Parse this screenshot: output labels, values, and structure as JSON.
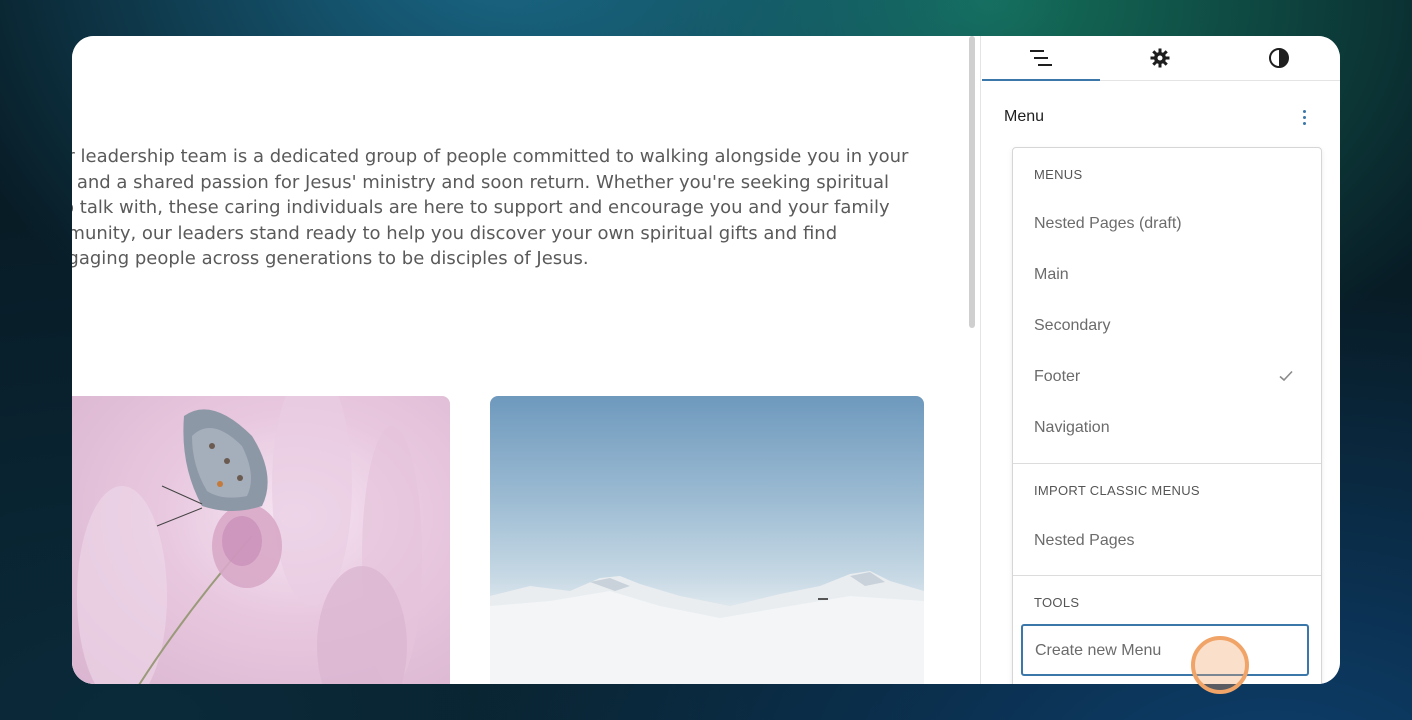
{
  "content": {
    "paragraph_lines": [
      "ur leadership team is a dedicated group of people committed to walking alongside you in your",
      "s, and a shared passion for Jesus' ministry and soon return. Whether you're seeking spiritual",
      "to talk with, these caring individuals are here to support and encourage you and your family",
      "nmunity, our leaders stand ready to help you discover your own spiritual gifts and find",
      "ngaging people across generations to be disciples of Jesus."
    ]
  },
  "sidebar": {
    "tabs": [
      {
        "icon": "list-view-icon",
        "active": true
      },
      {
        "icon": "gear-icon",
        "active": false
      },
      {
        "icon": "contrast-icon",
        "active": false
      }
    ],
    "menu_title": "Menu",
    "dropdown": {
      "menus_label": "MENUS",
      "menus": [
        "Nested Pages (draft)",
        "Main",
        "Secondary",
        "Footer",
        "Navigation"
      ],
      "selected": "Footer",
      "import_label": "IMPORT CLASSIC MENUS",
      "import_items": [
        "Nested Pages"
      ],
      "tools_label": "TOOLS",
      "create_label": "Create new Menu"
    }
  },
  "colors": {
    "accent": "#3b77a8",
    "cursor": "#f0a467"
  }
}
